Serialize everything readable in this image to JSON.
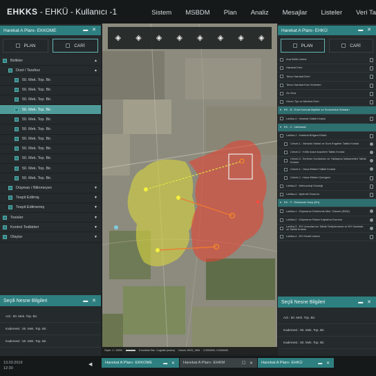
{
  "app": {
    "title_bold": "EHKKS",
    "title_rest": " - EHKÜ - Kullanıcı -1"
  },
  "menu": [
    "Sistem",
    "MSBDM",
    "Plan",
    "Analiz",
    "Mesajlar",
    "Listeler",
    "Veri Ta"
  ],
  "left_panel": {
    "title": "Harekat A Planı- EKKOME",
    "modes": {
      "plan": "PLAN",
      "cari": "CARİ",
      "active": "cari"
    },
    "tree": [
      {
        "label": "Birlikler",
        "level": 0,
        "arrow": "▲",
        "group": true
      },
      {
        "label": "Dost / Tarafsız",
        "level": 1,
        "arrow": "▲"
      },
      {
        "label": "50. Mek. Top. Bir.",
        "level": 2
      },
      {
        "label": "50. Mek. Top. Bir.",
        "level": 2
      },
      {
        "label": "50. Mek. Top. Bir.",
        "level": 2
      },
      {
        "label": "50. Mek. Top. Bir.",
        "level": 2,
        "selected": true
      },
      {
        "label": "50. Mek. Top. Bir.",
        "level": 2
      },
      {
        "label": "50. Mek. Top. Bir.",
        "level": 2
      },
      {
        "label": "50. Mek. Top. Bir.",
        "level": 2
      },
      {
        "label": "50. Mek. Top. Bir.",
        "level": 2
      },
      {
        "label": "50. Mek. Top. Bir.",
        "level": 2
      },
      {
        "label": "50. Mek. Top. Bir.",
        "level": 2
      },
      {
        "label": "50. Mek. Top. Bir.",
        "level": 2
      },
      {
        "label": "Düşman / Bilinmeyen",
        "level": 1,
        "arrow": "▼"
      },
      {
        "label": "Tespit Edilmiş",
        "level": 1,
        "arrow": "▼"
      },
      {
        "label": "Tespit Edilmemiş",
        "level": 1,
        "arrow": "▼"
      },
      {
        "label": "Tesisler",
        "level": 0,
        "arrow": "▼",
        "group": true
      },
      {
        "label": "Kontrol Tedbirleri",
        "level": 0,
        "arrow": "▼",
        "group": true
      },
      {
        "label": "Olaylar",
        "level": 0,
        "arrow": "▼",
        "group": true
      }
    ],
    "info_title": "Seçili Nesne Bilgileri",
    "info_lines": [
      "Adı : 50. Mek. Top. Bir.",
      "Kademesi : 50. Mek. Top. Bir.",
      "Kademesi : 50. Mek. Top. Bir."
    ]
  },
  "right_panel": {
    "title": "Harekat A Planı- EHKÜ",
    "modes": {
      "plan": "PLAN",
      "cari": "CARİ",
      "active": "plan"
    },
    "items": [
      {
        "label": "Ana Birlik Listesi",
        "icon": "list"
      },
      {
        "label": "Harekat Emri",
        "icon": "doc"
      },
      {
        "label": "Tebur Harekat Emri",
        "icon": "doc"
      },
      {
        "label": "Tebur Harekat Emri Kriterleri",
        "icon": "doc"
      },
      {
        "label": "Ön Emir",
        "icon": "doc"
      },
      {
        "label": "Görev Tipi ve Mürfent Emri",
        "icon": "doc"
      },
      {
        "label": "EK - B : Emir Komuta İlişkileri ve Sorumluluk Sahaları",
        "section": true
      },
      {
        "label": "Lahika 4 : Harekat Tatbik Krokisi",
        "icon": "doc"
      },
      {
        "label": "EK - C : İstihbarat",
        "section": true
      },
      {
        "label": "Lahika-1 : Harekat Bölgesi Etüdü",
        "icon": "doc"
      },
      {
        "label": "Cetvel-1 : Meskûn Mahal ve Sum Engeller Tatbik Krokisi",
        "indent": true,
        "icon": "dot"
      },
      {
        "label": "Cetvel-2 : Kritik Arazi Arazeleri Tatbik Krokisi",
        "indent": true,
        "icon": "dot"
      },
      {
        "label": "Cetvel-3 : İlerleme Koridorları ve Yaklaşma İstikametleri Tatbik Krokisi",
        "indent": true,
        "icon": "dot"
      },
      {
        "label": "Cetvel-1 : Hava Etkileri Tatbik Krokisi",
        "indent": true,
        "icon": "dot"
      },
      {
        "label": "Cetvel-J : Hava Etkileri Çizelgesi",
        "indent": true,
        "icon": "doc"
      },
      {
        "label": "Lahika-2 : Meteoroloji Desteği",
        "icon": "doc"
      },
      {
        "label": "Lahika-4 : Aydınlık Durumu",
        "icon": "doc"
      },
      {
        "label": "EK - F : Elektronik Harp (EH)",
        "section": true
      },
      {
        "label": "Lahika-1 : Düşmanın Elektronik Muh. Düzeni (EMD)",
        "icon": "dot"
      },
      {
        "label": "Lahika-2 : Düşmanın Radar Kaplama Durumu",
        "icon": "dot"
      },
      {
        "label": "Lahika-3 : EH Unsurlarının Tatbik Tertiplenmesi ve EH Harekatı ve Tatbik Krokisi",
        "icon": "dot"
      },
      {
        "label": "Lahika-4 : EH Hedef Listesi",
        "icon": "doc"
      }
    ],
    "info_title": "Seçili Nesne Bilgileri",
    "info_lines": [
      "Adı : 50. Mek. Top. Bir.",
      "Kademesi : 50. Mek. Top. Bir.",
      "Kademesi : 50. Mek. Top. Bir."
    ]
  },
  "map": {
    "tool_count": 8,
    "status": [
      "Ölçek: 1 / 15000",
      "Koordinat Sist.: Coğrafik (enlem)",
      "Datum: WGS_1984",
      "0.0000000, 0.0000000"
    ]
  },
  "bottom": {
    "date": "13.03.2019",
    "time": "12:30",
    "tabs": [
      "Harekat A Planı- EKKOME",
      "Harekat A Planı- EHKM",
      "Harekat A Planı- EHKÜ"
    ]
  }
}
